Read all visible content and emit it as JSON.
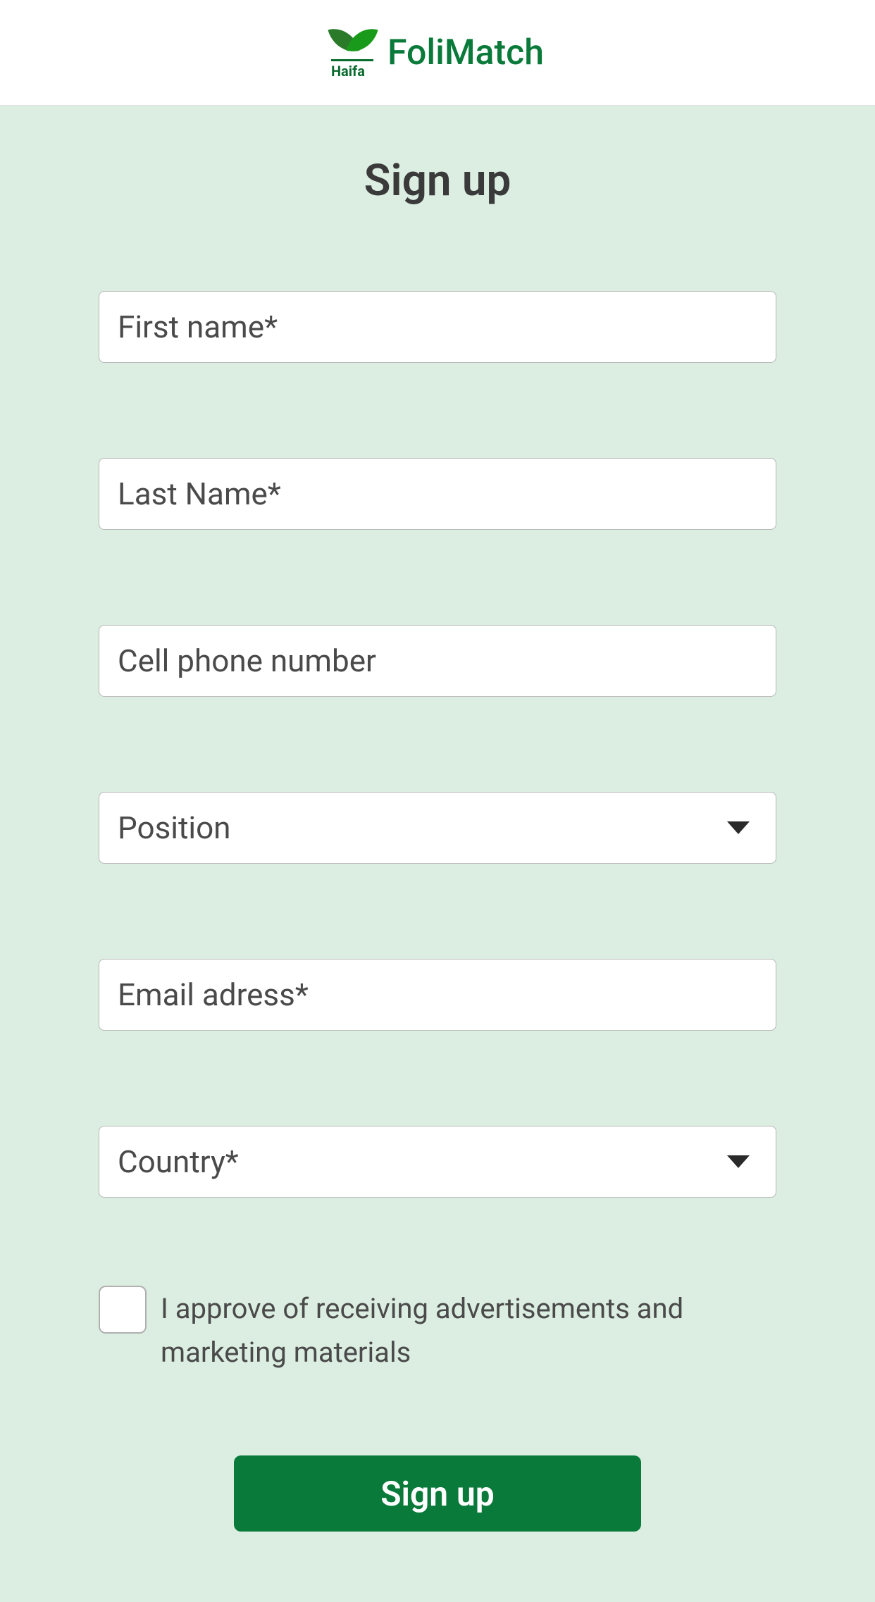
{
  "header": {
    "brand_sub": "Haifa",
    "app_name": "FoliMatch"
  },
  "page": {
    "title": "Sign up"
  },
  "form": {
    "first_name": {
      "placeholder": "First name*",
      "value": ""
    },
    "last_name": {
      "placeholder": "Last Name*",
      "value": ""
    },
    "cell_phone": {
      "placeholder": "Cell phone number",
      "value": ""
    },
    "position": {
      "selected": "Position"
    },
    "email": {
      "placeholder": "Email adress*",
      "value": ""
    },
    "country": {
      "selected": "Country*"
    },
    "consent": {
      "checked": false,
      "label": "I approve of receiving advertisements and marketing materials"
    },
    "submit_label": "Sign up"
  }
}
